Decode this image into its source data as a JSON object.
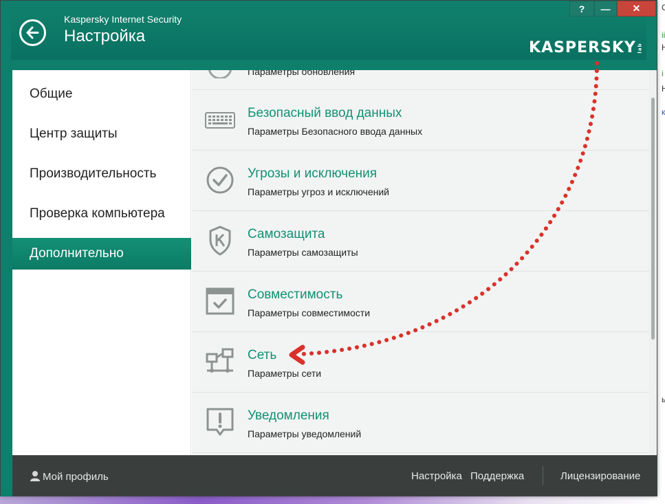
{
  "window": {
    "app_name": "Kaspersky Internet Security",
    "title": "Настройка",
    "logo": "KASPERSKY",
    "logo_suffix": "lab",
    "help_label": "?",
    "minimize_label": "—",
    "close_label": "✕"
  },
  "sidebar": {
    "items": [
      {
        "label": "Общие",
        "active": false
      },
      {
        "label": "Центр защиты",
        "active": false
      },
      {
        "label": "Производительность",
        "active": false
      },
      {
        "label": "Проверка компьютера",
        "active": false
      },
      {
        "label": "Дополнительно",
        "active": true
      }
    ]
  },
  "content": {
    "partial_row_subtitle": "Параметры обновления",
    "rows": [
      {
        "title": "Безопасный ввод данных",
        "subtitle": "Параметры Безопасного ввода данных",
        "icon": "keyboard-icon"
      },
      {
        "title": "Угрозы и исключения",
        "subtitle": "Параметры угроз и исключений",
        "icon": "checkmark-circle-icon"
      },
      {
        "title": "Самозащита",
        "subtitle": "Параметры самозащиты",
        "icon": "shield-icon"
      },
      {
        "title": "Совместимость",
        "subtitle": "Параметры совместимости",
        "icon": "compatibility-window-icon"
      },
      {
        "title": "Сеть",
        "subtitle": "Параметры сети",
        "icon": "network-icon"
      },
      {
        "title": "Уведомления",
        "subtitle": "Параметры уведомлений",
        "icon": "notification-icon"
      }
    ]
  },
  "footer": {
    "profile": "Мой профиль",
    "settings": "Настройка",
    "support": "Поддержка",
    "licensing": "Лицензирование"
  },
  "colors": {
    "header": "#0f7f6b",
    "accent_text": "#139074",
    "annotation_arrow": "#d9322b",
    "footer": "#3a3f3e"
  }
}
